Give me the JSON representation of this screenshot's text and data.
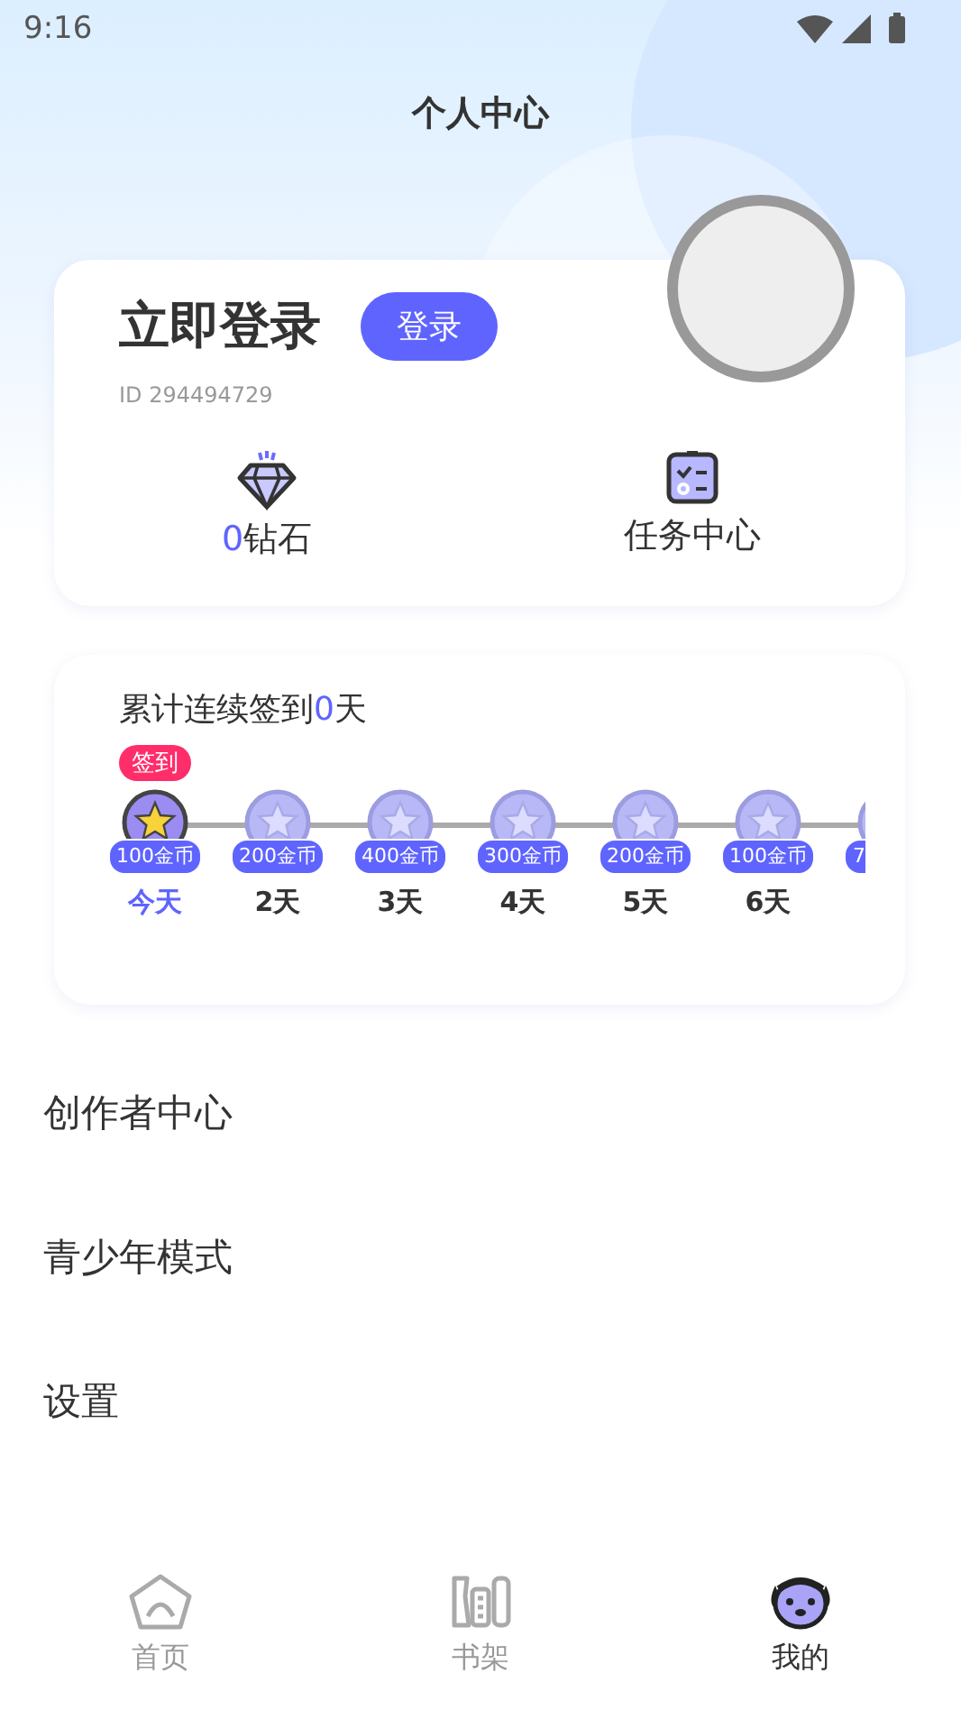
{
  "status_bar": {
    "time": "9:16"
  },
  "header": {
    "title": "个人中心"
  },
  "profile": {
    "name": "立即登录",
    "login_button": "登录",
    "id": "ID 294494729"
  },
  "stats": [
    {
      "kind": "diamond",
      "value": "0",
      "label": "钻石"
    },
    {
      "kind": "task",
      "label": "任务中心"
    }
  ],
  "checkin": {
    "summary_prefix": "累计连续签到",
    "count": "0",
    "summary_suffix": "天",
    "badge": "签到",
    "days": [
      {
        "reward": "100金币",
        "label": "今天",
        "selected": true
      },
      {
        "reward": "200金币",
        "label": "2天",
        "selected": false
      },
      {
        "reward": "400金币",
        "label": "3天",
        "selected": false
      },
      {
        "reward": "300金币",
        "label": "4天",
        "selected": false
      },
      {
        "reward": "200金币",
        "label": "5天",
        "selected": false
      },
      {
        "reward": "100金币",
        "label": "6天",
        "selected": false
      },
      {
        "reward": "7",
        "selected": false
      }
    ]
  },
  "menu": [
    "创作者中心",
    "青少年模式",
    "设置"
  ],
  "tabs": [
    {
      "kind": "home",
      "label": "首页",
      "selected": false
    },
    {
      "kind": "shelf",
      "label": "书架",
      "selected": false
    },
    {
      "kind": "mine",
      "label": "我的",
      "selected": true
    }
  ]
}
